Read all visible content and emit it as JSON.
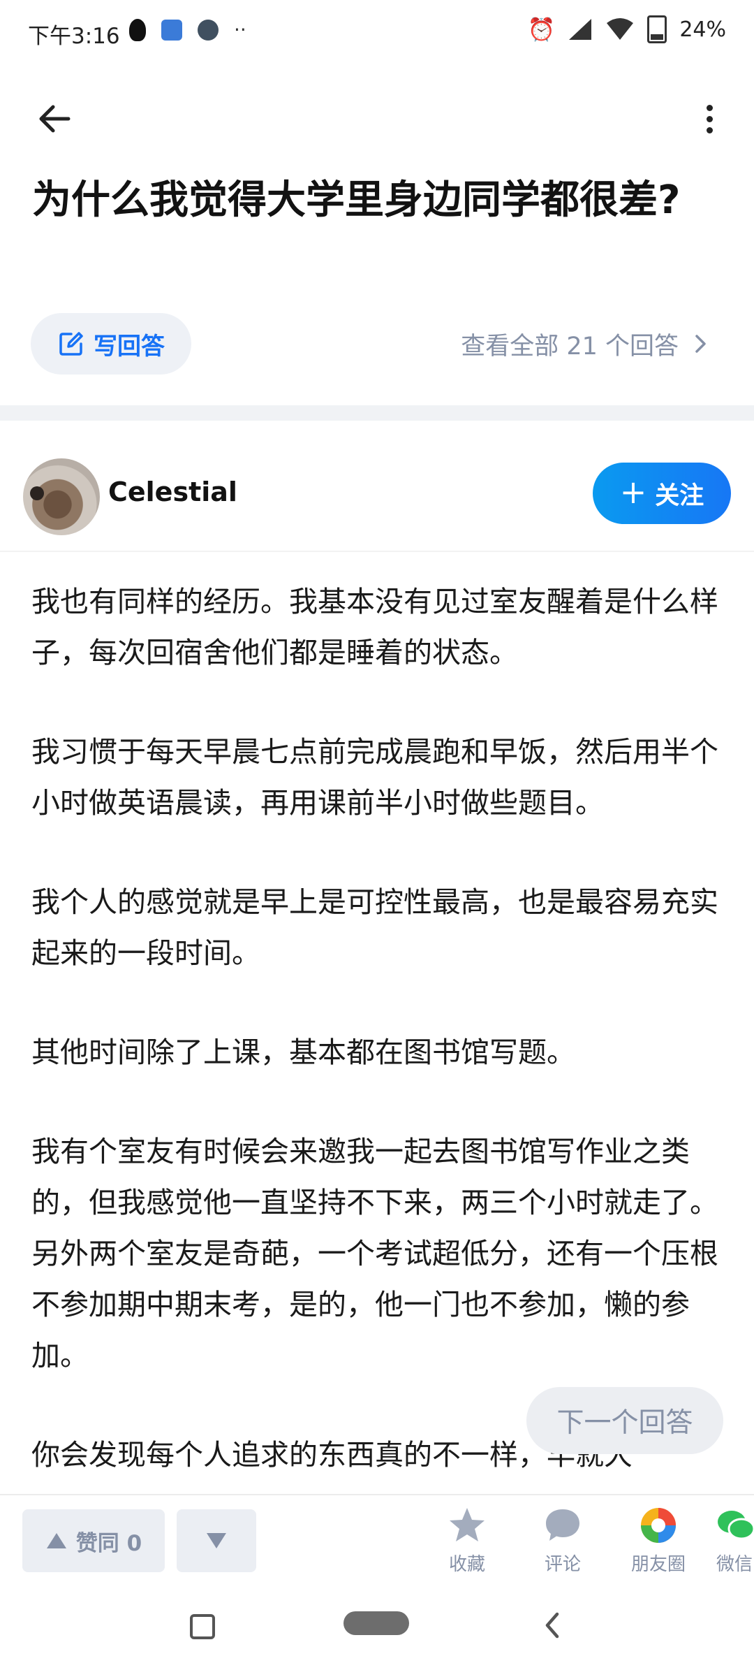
{
  "status_bar": {
    "time": "下午3:16",
    "battery": "24%",
    "left_icons": [
      "qq-icon",
      "app-icon",
      "app-icon",
      "more-icon"
    ],
    "right_icons": [
      "alarm-icon",
      "hd-signal-icon",
      "wifi-icon",
      "battery-icon"
    ]
  },
  "header": {
    "title": "为什么我觉得大学里身边同学都很差?"
  },
  "actions": {
    "write_answer": "写回答",
    "view_all": "查看全部 21 个回答"
  },
  "author": {
    "name": "Celestial",
    "follow_label": "关注"
  },
  "answer": {
    "paragraphs": [
      "我也有同样的经历。我基本没有见过室友醒着是什么样子，每次回宿舍他们都是睡着的状态。",
      "我习惯于每天早晨七点前完成晨跑和早饭，然后用半个小时做英语晨读，再用课前半小时做些题目。",
      "我个人的感觉就是早上是可控性最高，也是最容易充实起来的一段时间。",
      "其他时间除了上课，基本都在图书馆写题。",
      "我有个室友有时候会来邀我一起去图书馆写作业之类的，但我感觉他一直坚持不下来，两三个小时就走了。另外两个室友是奇葩，一个考试超低分，还有一个压根不参加期中期末考，是的，他一门也不参加，懒的参加。",
      "你会发现每个人追求的东西真的不一样，早就大"
    ]
  },
  "next_answer": "下一个回答",
  "bottom_bar": {
    "upvote_label": "赞同 0",
    "favorite": "收藏",
    "comment": "评论",
    "moments": "朋友圈",
    "wechat": "微信"
  },
  "colors": {
    "accent": "#1772f6",
    "muted": "#8590a6",
    "follow_gradient_start": "#0a9af0",
    "follow_gradient_end": "#1777f5",
    "divider": "#f0f2f5"
  }
}
